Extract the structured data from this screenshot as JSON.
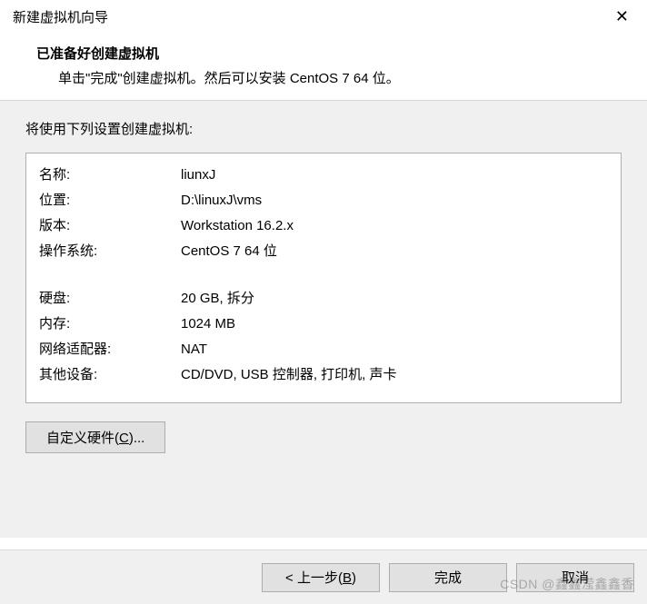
{
  "window": {
    "title": "新建虚拟机向导"
  },
  "header": {
    "title": "已准备好创建虚拟机",
    "subtitle": "单击\"完成\"创建虚拟机。然后可以安装 CentOS 7 64 位。"
  },
  "prompt": "将使用下列设置创建虚拟机:",
  "settings": {
    "rows_a": [
      {
        "label": "名称:",
        "value": "liunxJ"
      },
      {
        "label": "位置:",
        "value": "D:\\linuxJ\\vms"
      },
      {
        "label": "版本:",
        "value": "Workstation 16.2.x"
      },
      {
        "label": "操作系统:",
        "value": "CentOS 7 64 位"
      }
    ],
    "rows_b": [
      {
        "label": "硬盘:",
        "value": "20 GB, 拆分"
      },
      {
        "label": "内存:",
        "value": "1024 MB"
      },
      {
        "label": "网络适配器:",
        "value": "NAT"
      },
      {
        "label": "其他设备:",
        "value": "CD/DVD, USB 控制器, 打印机, 声卡"
      }
    ]
  },
  "buttons": {
    "customize_pre": "自定义硬件(",
    "customize_hotkey": "C",
    "customize_post": ")...",
    "back_pre": "< 上一步(",
    "back_hotkey": "B",
    "back_post": ")",
    "finish": "完成",
    "cancel": "取消"
  },
  "watermark": "CSDN @鑫鑫滢鑫鑫香"
}
